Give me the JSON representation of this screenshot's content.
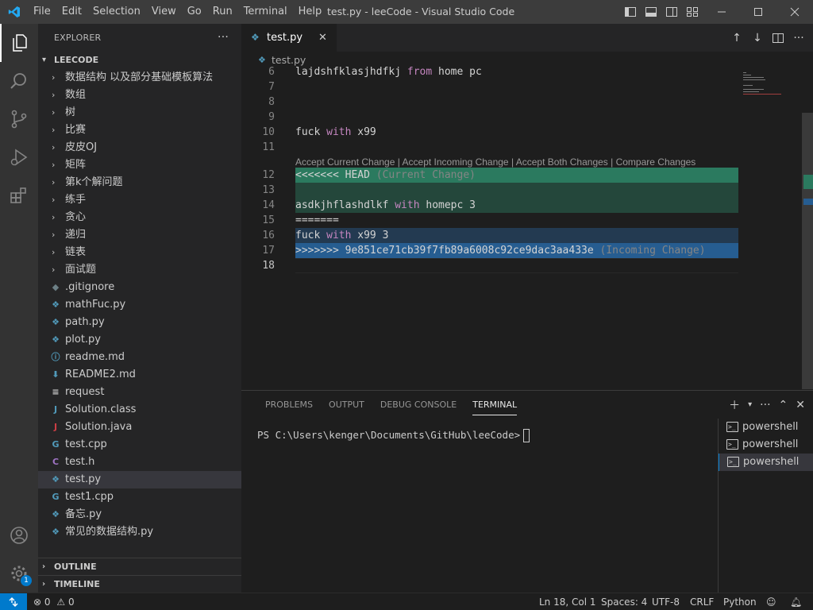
{
  "titlebar": {
    "menu": [
      "File",
      "Edit",
      "Selection",
      "View",
      "Go",
      "Run",
      "Terminal",
      "Help"
    ],
    "window_title": "test.py - leeCode - Visual Studio Code"
  },
  "explorer": {
    "title": "EXPLORER",
    "more": "···",
    "root": "LEECODE",
    "folders": [
      "数据结构 以及部分基础模板算法",
      "数组",
      "树",
      "比赛",
      "皮皮OJ",
      "矩阵",
      "第k个解问题",
      "练手",
      "贪心",
      "递归",
      "链表",
      "面试题"
    ],
    "files": [
      {
        "name": ".gitignore",
        "icon": "gitignore-icon",
        "glyph": "◆",
        "color": "#6d8086"
      },
      {
        "name": "mathFuc.py",
        "icon": "python-icon",
        "glyph": "❖",
        "color": "#519aba"
      },
      {
        "name": "path.py",
        "icon": "python-icon",
        "glyph": "❖",
        "color": "#519aba"
      },
      {
        "name": "plot.py",
        "icon": "python-icon",
        "glyph": "❖",
        "color": "#519aba"
      },
      {
        "name": "readme.md",
        "icon": "info-icon",
        "glyph": "ⓘ",
        "color": "#519aba"
      },
      {
        "name": "README2.md",
        "icon": "download-icon",
        "glyph": "⬇",
        "color": "#519aba"
      },
      {
        "name": "request",
        "icon": "text-file-icon",
        "glyph": "≡",
        "color": "#cccccc"
      },
      {
        "name": "Solution.class",
        "icon": "java-icon",
        "glyph": "J",
        "color": "#519aba"
      },
      {
        "name": "Solution.java",
        "icon": "java-icon",
        "glyph": "J",
        "color": "#cc3e44"
      },
      {
        "name": "test.cpp",
        "icon": "cpp-icon",
        "glyph": "G",
        "color": "#519aba"
      },
      {
        "name": "test.h",
        "icon": "c-header-icon",
        "glyph": "C",
        "color": "#a074c4"
      },
      {
        "name": "test.py",
        "icon": "python-icon",
        "glyph": "❖",
        "color": "#519aba",
        "selected": true
      },
      {
        "name": "test1.cpp",
        "icon": "cpp-icon",
        "glyph": "G",
        "color": "#519aba"
      },
      {
        "name": "备忘.py",
        "icon": "python-icon",
        "glyph": "❖",
        "color": "#519aba"
      },
      {
        "name": "常见的数据结构.py",
        "icon": "python-icon",
        "glyph": "❖",
        "color": "#519aba"
      }
    ],
    "outline": "OUTLINE",
    "timeline": "TIMELINE"
  },
  "editor": {
    "tab_label": "test.py",
    "tab_close": "✕",
    "breadcrumb": "test.py",
    "codelens": "Accept Current Change | Accept Incoming Change | Accept Both Changes | Compare Changes",
    "lines": [
      {
        "n": "6",
        "pre": "lajdshfklasjhdfkj ",
        "kw": "from",
        "post": " home pc",
        "bg": ""
      },
      {
        "n": "7",
        "pre": "",
        "kw": "",
        "post": "",
        "bg": ""
      },
      {
        "n": "8",
        "pre": "",
        "kw": "",
        "post": "",
        "bg": ""
      },
      {
        "n": "9",
        "pre": "",
        "kw": "",
        "post": "",
        "bg": ""
      },
      {
        "n": "10",
        "pre": "fuck ",
        "kw": "with",
        "post": " x99",
        "bg": ""
      },
      {
        "n": "11",
        "pre": "",
        "kw": "",
        "post": "",
        "bg": ""
      },
      {
        "n": "12",
        "pre": "<<<<<<< HEAD ",
        "kw": "",
        "post": "",
        "dim": "(Current Change)",
        "bg": "cur-head"
      },
      {
        "n": "13",
        "pre": "",
        "kw": "",
        "post": "",
        "bg": "cur-body"
      },
      {
        "n": "14",
        "pre": "asdkjhflashdlkf ",
        "kw": "with",
        "post": " homepc 3",
        "bg": "cur-body"
      },
      {
        "n": "15",
        "pre": "=======",
        "kw": "",
        "post": "",
        "bg": ""
      },
      {
        "n": "16",
        "pre": "fuck ",
        "kw": "with",
        "post": " x99 3",
        "bg": "inc-body"
      },
      {
        "n": "17",
        "pre": ">>>>>>> 9e851ce71cb39f7fb89a6008c92ce9dac3aa433e ",
        "kw": "",
        "post": "",
        "dim": "(Incoming Change)",
        "bg": "inc-head"
      },
      {
        "n": "18",
        "pre": "",
        "kw": "",
        "post": "",
        "bg": "",
        "current": true
      }
    ]
  },
  "panel": {
    "tabs": [
      "PROBLEMS",
      "OUTPUT",
      "DEBUG CONSOLE",
      "TERMINAL"
    ],
    "active_tab": "TERMINAL",
    "prompt": "PS C:\\Users\\kenger\\Documents\\GitHub\\leeCode>",
    "terminals": [
      "powershell",
      "powershell",
      "powershell"
    ],
    "active_terminal": 2
  },
  "statusbar": {
    "errors": "0",
    "warnings": "0",
    "position": "Ln 18, Col 1",
    "spaces": "Spaces: 4",
    "encoding": "UTF-8",
    "eol": "CRLF",
    "language": "Python"
  },
  "accounts_badge": "1",
  "colors": {
    "accent": "#007acc",
    "current_change": "#2b7a5f",
    "incoming_change": "#265d91",
    "keyword": "#c586c0"
  }
}
